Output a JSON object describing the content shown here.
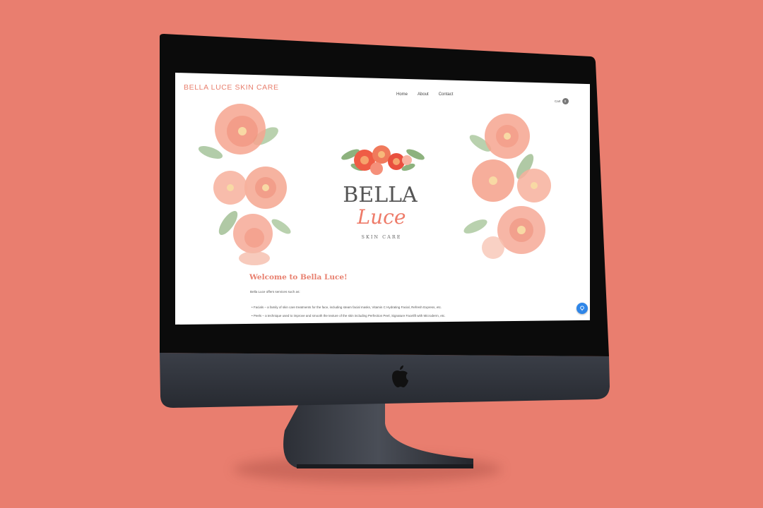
{
  "site": {
    "title": "BELLA LUCE SKIN CARE",
    "nav": [
      "Home",
      "About",
      "Contact"
    ],
    "cart_label": "Cart",
    "cart_count": "0"
  },
  "logo": {
    "line1": "BELLA",
    "line2": "Luce",
    "line3": "SKIN CARE"
  },
  "content": {
    "heading": "Welcome to Bella Luce!",
    "intro": "Bella Luce offers services such as:",
    "bullets": [
      "• Facials – a family of skin care treatments for the face, including steam facial masks, Vitamin C Hydrating Facial, Refresh Express, etc.",
      "• Peels – a technique used to improve and smooth the texture of the skin including Perfection Peel, Signature Facelift with Microderm, etc."
    ]
  },
  "colors": {
    "background": "#e97e6f",
    "accent": "#e8806f",
    "chat": "#2f86e8"
  },
  "icons": [
    "apple-icon",
    "cart-icon",
    "chat-icon"
  ]
}
